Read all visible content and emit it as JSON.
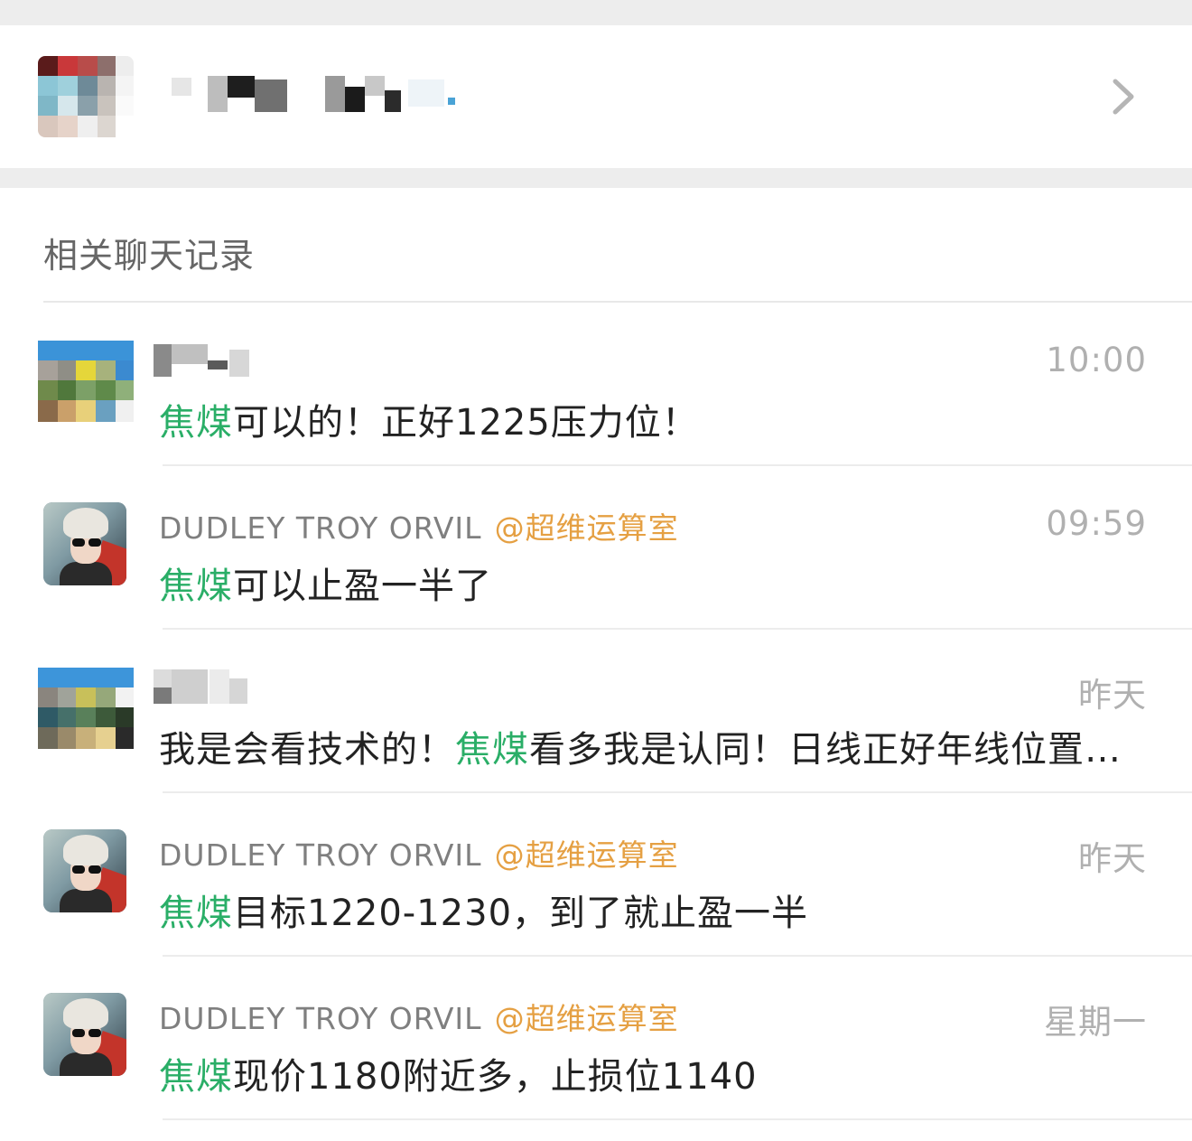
{
  "section_title": "相关聊天记录",
  "colors": {
    "keyword": "#2aae67",
    "group_tag": "#e5a043",
    "time": "#b0b0b0"
  },
  "icons": {
    "chevron": "chevron-right-icon"
  },
  "results": [
    {
      "sender": "",
      "group_tag": "",
      "time": "10:00",
      "keyword": "焦煤",
      "pre": "",
      "post": "可以的！正好1225压力位！"
    },
    {
      "sender": "DUDLEY TROY ORVIL",
      "group_tag": "@超维运算室",
      "time": "09:59",
      "keyword": "焦煤",
      "pre": "",
      "post": "可以止盈一半了"
    },
    {
      "sender": "",
      "group_tag": "",
      "time": "昨天",
      "keyword": "焦煤",
      "pre": "我是会看技术的！",
      "post": "看多我是认同！日线正好年线位置…"
    },
    {
      "sender": "DUDLEY TROY ORVIL",
      "group_tag": "@超维运算室",
      "time": "昨天",
      "keyword": "焦煤",
      "pre": "",
      "post": "目标1220-1230，到了就止盈一半"
    },
    {
      "sender": "DUDLEY TROY ORVIL",
      "group_tag": "@超维运算室",
      "time": "星期一",
      "keyword": "焦煤",
      "pre": "",
      "post": "现价1180附近多，止损位1140"
    }
  ]
}
